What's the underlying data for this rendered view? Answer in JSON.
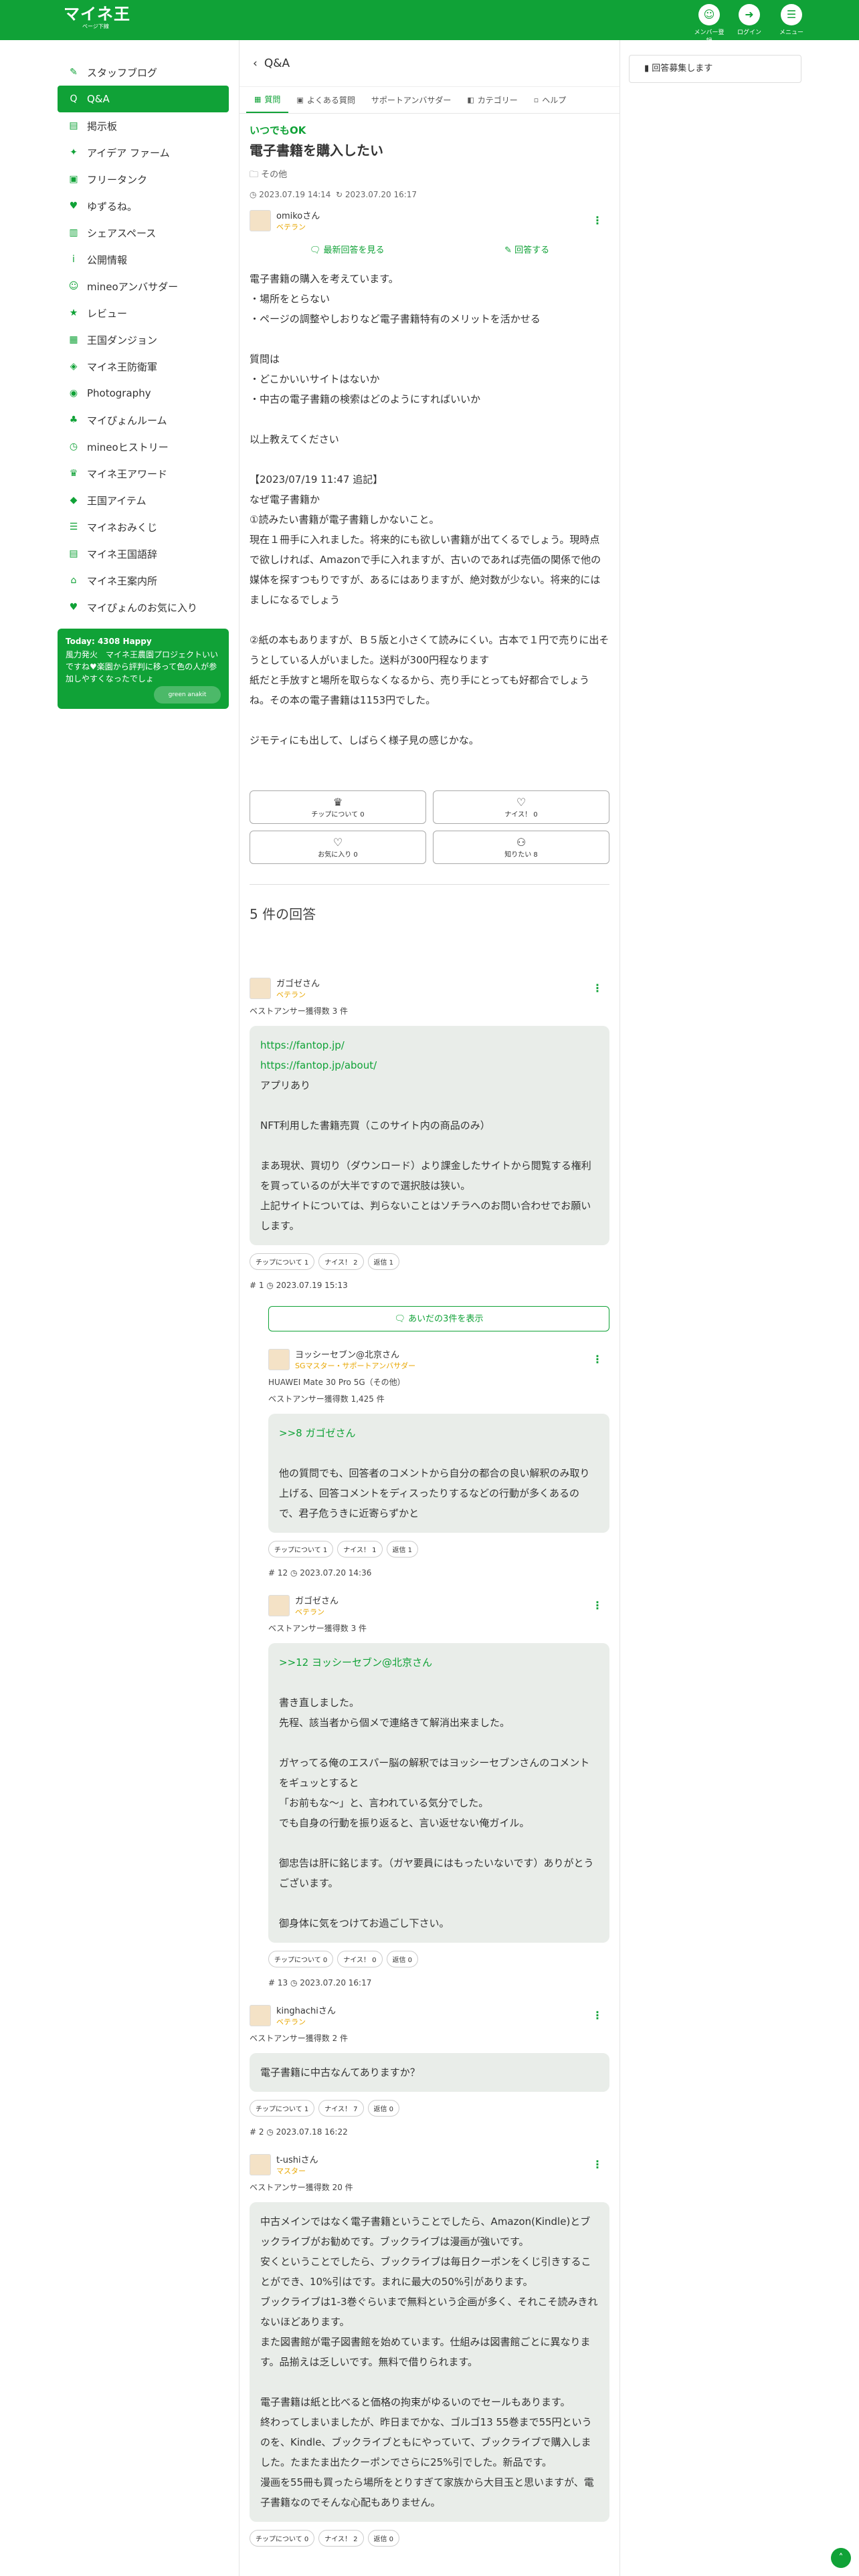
{
  "header": {
    "logo_title": "マイネ王",
    "logo_sub": "ページ下線",
    "member_label": "メンバー登録",
    "login_label": "ログイン",
    "menu_label": "メニュー"
  },
  "sidebar": {
    "items": [
      {
        "label": "スタッフブログ",
        "icon": "pencil-icon",
        "active": false
      },
      {
        "label": "Q&A",
        "icon": "qa-icon",
        "active": true
      },
      {
        "label": "掲示板",
        "icon": "board-icon",
        "active": false
      },
      {
        "label": "アイデア ファーム",
        "icon": "bulb-icon",
        "active": false
      },
      {
        "label": "フリータンク",
        "icon": "tank-icon",
        "active": false
      },
      {
        "label": "ゆずるね。",
        "icon": "handshake-icon",
        "active": false
      },
      {
        "label": "シェアスペース",
        "icon": "chart-icon",
        "active": false
      },
      {
        "label": "公開情報",
        "icon": "info-icon",
        "active": false
      },
      {
        "label": "mineoアンバサダー",
        "icon": "ambassador-icon",
        "active": false
      },
      {
        "label": "レビュー",
        "icon": "review-icon",
        "active": false
      },
      {
        "label": "王国ダンジョン",
        "icon": "dungeon-icon",
        "active": false
      },
      {
        "label": "マイネ王防衛軍",
        "icon": "shield-icon",
        "active": false
      },
      {
        "label": "Photography",
        "icon": "camera-icon",
        "active": false
      },
      {
        "label": "マイぴょんルーム",
        "icon": "rabbit-icon",
        "active": false
      },
      {
        "label": "mineoヒストリー",
        "icon": "history-icon",
        "active": false
      },
      {
        "label": "マイネ王アワード",
        "icon": "trophy-icon",
        "active": false
      },
      {
        "label": "王国アイテム",
        "icon": "item-icon",
        "active": false
      },
      {
        "label": "マイネおみくじ",
        "icon": "omikuji-icon",
        "active": false
      },
      {
        "label": "マイネ王国語辞",
        "icon": "dictionary-icon",
        "active": false
      },
      {
        "label": "マイネ王案内所",
        "icon": "guide-icon",
        "active": false
      },
      {
        "label": "マイぴょんのお気に入り",
        "icon": "favorite-icon",
        "active": false
      }
    ],
    "banner": {
      "title": "Today: 4308 Happy",
      "text": "風力発火　マイネ王農園プロジェクトいいですね♥楽園から評判に移って色の人が参加しやすくなったでしょ",
      "logo": "green anakit"
    }
  },
  "main": {
    "back_label": "Q&A",
    "tabs": [
      "質問",
      "よくある質問",
      "サポートアンバサダー",
      "カテゴリー",
      "ヘルプ"
    ]
  },
  "question": {
    "badge": "いつでもOK",
    "title": "電子書籍を購入したい",
    "category": "その他",
    "posted": "2023.07.19 14:14",
    "updated": "2023.07.20 16:17",
    "author": "omikoさん",
    "rank": "ベテラン",
    "link_latest": "最新回答を見る",
    "link_answer": "回答する",
    "body": [
      "電子書籍の購入を考えています。",
      "・場所をとらない",
      "・ページの調整やしおりなど電子書籍特有のメリットを活かせる",
      "",
      "質問は",
      "・どこかいいサイトはないか",
      "・中古の電子書籍の検索はどのようにすればいいか",
      "",
      "以上教えてください",
      "",
      "【2023/07/19 11:47 追記】",
      "なぜ電子書籍か",
      "①読みたい書籍が電子書籍しかないこと。",
      "現在１冊手に入れました。将来的にも欲しい書籍が出てくるでしょう。現時点で欲しければ、Amazonで手に入れますが、古いのであれば売価の関係で他の媒体を探すつもりですが、あるにはありますが、絶対数が少ない。将来的にはましになるでしょう",
      "",
      "②紙の本もありますが、Ｂ５版と小さくて読みにくい。古本で１円で売りに出そうとしている人がいました。送料が300円程なります",
      "紙だと手放すと場所を取らなくなるから、売り手にとっても好都合でしょうね。その本の電子書籍は1153円でした。",
      "",
      "ジモティにも出して、しばらく様子見の感じかな。"
    ],
    "buttons": [
      {
        "label": "チップについて 0"
      },
      {
        "label": "ナイス！ 0"
      },
      {
        "label": "お気に入り 0"
      },
      {
        "label": "知りたい 8"
      }
    ]
  },
  "answers_title": "5 件の回答",
  "answers": [
    {
      "author": "ガゴゼさん",
      "rank": "ベテラン",
      "best": "ベストアンサー獲得数 3 件",
      "lines": [
        "https://fantop.jp/",
        "https://fantop.jp/about/",
        "アプリあり",
        "",
        "NFT利用した書籍売買（このサイト内の商品のみ）",
        "",
        "まあ現状、買切り（ダウンロード）より課金したサイトから閲覧する権利を買っているのが大半ですので選択肢は狭い。",
        "上記サイトについては、判らないことはソチラへのお問い合わせでお願いします。"
      ],
      "chip": "チップについて 1",
      "nice": "ナイス！ 2",
      "reply": "返信 1",
      "num": "1",
      "time": "2023.07.19 15:13"
    },
    {
      "show_more": "あいだの3件を表示"
    },
    {
      "author": "ヨッシーセブン@北京さん",
      "rank": "SGマスター・サポートアンバサダー",
      "device": "HUAWEI Mate 30 Pro 5G（その他）",
      "best": "ベストアンサー獲得数 1,425 件",
      "lines": [
        ">>8 ガゴゼさん",
        "",
        "他の質問でも、回答者のコメントから自分の都合の良い解釈のみ取り上げる、回答コメントをディスったりするなどの行動が多くあるので、君子危うきに近寄らずかと"
      ],
      "chip": "チップについて 1",
      "nice": "ナイス！ 1",
      "reply": "返信 1",
      "num": "12",
      "time": "2023.07.20 14:36"
    },
    {
      "author": "ガゴゼさん",
      "rank": "ベテラン",
      "best": "ベストアンサー獲得数 3 件",
      "lines": [
        ">>12 ヨッシーセブン@北京さん",
        "",
        "書き直しました。",
        "先程、該当者から個メで連絡きて解消出来ました。",
        "",
        "ガヤってる俺のエスパー脳の解釈ではヨッシーセブンさんのコメントをギュッとすると",
        "「お前もな〜」と、言われている気分でした。",
        "でも自身の行動を振り返ると、言い返せない俺ガイル。",
        "",
        "御忠告は肝に銘じます。（ガヤ要員にはもったいないです）ありがとうございます。",
        "",
        "御身体に気をつけてお過ごし下さい。"
      ],
      "chip": "チップについて 0",
      "nice": "ナイス！ 0",
      "reply": "返信 0",
      "num": "13",
      "time": "2023.07.20 16:17"
    },
    {
      "author": "kinghachiさん",
      "rank": "ベテラン",
      "best": "ベストアンサー獲得数 2 件",
      "lines": [
        "電子書籍に中古なんてありますか？"
      ],
      "chip": "チップについて 1",
      "nice": "ナイス！ 7",
      "reply": "返信 0",
      "num": "2",
      "time": "2023.07.18 16:22"
    },
    {
      "author": "t-ushiさん",
      "rank": "マスター",
      "best": "ベストアンサー獲得数 20 件",
      "lines": [
        "中古メインではなく電子書籍ということでしたら、Amazon(Kindle)とブックライブがお勧めです。ブックライブは漫画が強いです。",
        "安くということでしたら、ブックライブは毎日クーポンをくじ引きすることができ、10%引はです。まれに最大の50%引があります。",
        "ブックライブは1-3巻ぐらいまで無料という企画が多く、それこそ読みきれないほどあります。",
        "また図書館が電子図書館を始めています。仕組みは図書館ごとに異なります。品揃えは乏しいです。無料で借りられます。",
        "",
        "電子書籍は紙と比べると価格の拘束がゆるいのでセールもあります。",
        "終わってしまいましたが、昨日までかな、ゴルゴ13 55巻まで55円というのを、Kindle、ブックライブともにやっていて、ブックライブで購入しました。たまたま出たクーポンでさらに25%引でした。新品です。",
        "漫画を55冊も買ったら場所をとりすぎて家族から大目玉と思いますが、電子書籍なのでそんな心配もありません。"
      ],
      "chip": "チップについて 0",
      "nice": "ナイス！ 2",
      "reply": "返信 0",
      "num": "",
      "time": ""
    }
  ],
  "right": {
    "notice": "回答募集します"
  }
}
